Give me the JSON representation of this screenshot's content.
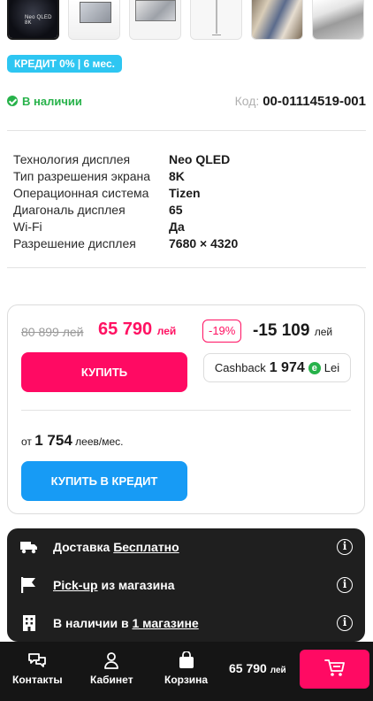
{
  "thumbnails": [
    {
      "name": "thumb-1",
      "brand": "Neo QLED 8K",
      "active": true
    },
    {
      "name": "thumb-2"
    },
    {
      "name": "thumb-3"
    },
    {
      "name": "thumb-4"
    },
    {
      "name": "thumb-5"
    },
    {
      "name": "thumb-6"
    }
  ],
  "credit_badge": "КРЕДИТ 0% | 6 мес.",
  "stock": {
    "status": "В наличии",
    "code_label": "Код:",
    "code_value": "00-01114519-001"
  },
  "specs": [
    {
      "key": "Технология дисплея",
      "value": "Neo QLED"
    },
    {
      "key": "Тип разрешения экрана",
      "value": "8K"
    },
    {
      "key": "Операционная система",
      "value": "Tizen"
    },
    {
      "key": "Диагональ дисплея",
      "value": "65"
    },
    {
      "key": "Wi-Fi",
      "value": "Да"
    },
    {
      "key": "Разрешение дисплея",
      "value": "7680 × 4320"
    }
  ],
  "price": {
    "old": "80 899 лей",
    "new": "65 790",
    "currency": "лей",
    "discount": "-19%",
    "saving": "-15 109",
    "saving_currency": "лей",
    "buy_label": "КУПИТЬ",
    "cashback_label": "Cashback",
    "cashback_value": "1 974",
    "cashback_icon": "e",
    "cashback_currency": "Lei",
    "monthly_prefix": "от",
    "monthly_value": "1 754",
    "monthly_suffix": "леев/мес.",
    "credit_label": "КУПИТЬ В КРЕДИТ"
  },
  "delivery": {
    "delivery_text": "Доставка",
    "delivery_link": "Бесплатно",
    "pickup_link": "Pick-up",
    "pickup_text": "из магазина",
    "stores_text": "В наличии в",
    "stores_link": "1 магазине",
    "info_glyph": "i"
  },
  "bottom_nav": {
    "contacts": "Контакты",
    "cabinet": "Кабинет",
    "cart": "Корзина",
    "total": "65 790",
    "total_currency": "лей"
  },
  "colors": {
    "accent_pink": "#ff0a63",
    "accent_blue": "#179bf5",
    "badge_cyan": "#2ec6f2",
    "stock_green": "#27b24a"
  }
}
